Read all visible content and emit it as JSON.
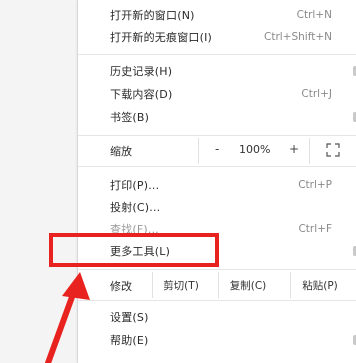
{
  "menu": {
    "items_top": [
      {
        "label": "打开新的窗口(N)",
        "shortcut": "Ctrl+N"
      },
      {
        "label": "打开新的无痕窗口(I)",
        "shortcut": "Ctrl+Shift+N"
      }
    ],
    "items_history": [
      {
        "label": "历史记录(H)",
        "shortcut": ""
      },
      {
        "label": "下载内容(D)",
        "shortcut": "Ctrl+J"
      },
      {
        "label": "书签(B)",
        "shortcut": ""
      }
    ],
    "zoom": {
      "label": "缩放",
      "minus": "-",
      "value": "100%",
      "plus": "+"
    },
    "items_tools": [
      {
        "label": "打印(P)...",
        "shortcut": "Ctrl+P"
      },
      {
        "label": "投射(C)...",
        "shortcut": ""
      },
      {
        "label": "查找(F)...",
        "shortcut": "Ctrl+F"
      },
      {
        "label": "更多工具(L)",
        "shortcut": ""
      }
    ],
    "edit": {
      "label": "修改",
      "cut": "剪切(T)",
      "copy": "复制(C)",
      "paste": "粘贴(P)"
    },
    "items_bottom": [
      {
        "label": "设置(S)",
        "shortcut": ""
      },
      {
        "label": "帮助(E)",
        "shortcut": ""
      }
    ]
  },
  "annotation": {
    "highlight_color": "#e8231f"
  }
}
